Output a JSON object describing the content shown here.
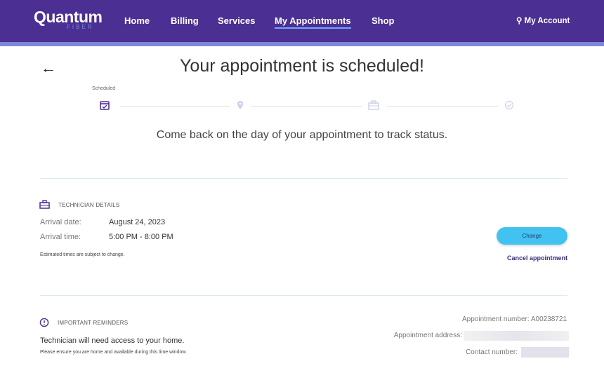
{
  "header": {
    "logo": "Quantum",
    "logo_sub": "FIBER",
    "nav": [
      "Home",
      "Billing",
      "Services",
      "My Appointments",
      "Shop"
    ],
    "active": "My Appointments",
    "account": "My Account"
  },
  "colors": {
    "brand": "#4c2f93",
    "accent": "#42c2f0"
  },
  "page": {
    "title": "Your appointment is scheduled!",
    "subtitle": "Come back on the day of your appointment to track status."
  },
  "stepper": {
    "current_label": "Scheduled",
    "steps": [
      "calendar-check-icon",
      "map-pin-icon",
      "toolbox-icon",
      "check-circle-icon"
    ],
    "current_index": 0
  },
  "technician": {
    "heading": "TECHNICIAN DETAILS",
    "date_label": "Arrival date:",
    "date": "August 24, 2023",
    "time_label": "Arrival time:",
    "time": "5:00 PM - 8:00 PM",
    "note": "Estimated times are subject to change.",
    "change": "Change",
    "cancel": "Cancel appointment"
  },
  "reminders": {
    "heading": "IMPORTANT REMINDERS",
    "main": "Technician will need access to your home.",
    "detail": "Please ensure you are home and available during this time window.",
    "appt_number": "Appointment number: A00238721",
    "address_label": "Appointment address:",
    "contact_label": "Contact number:"
  }
}
